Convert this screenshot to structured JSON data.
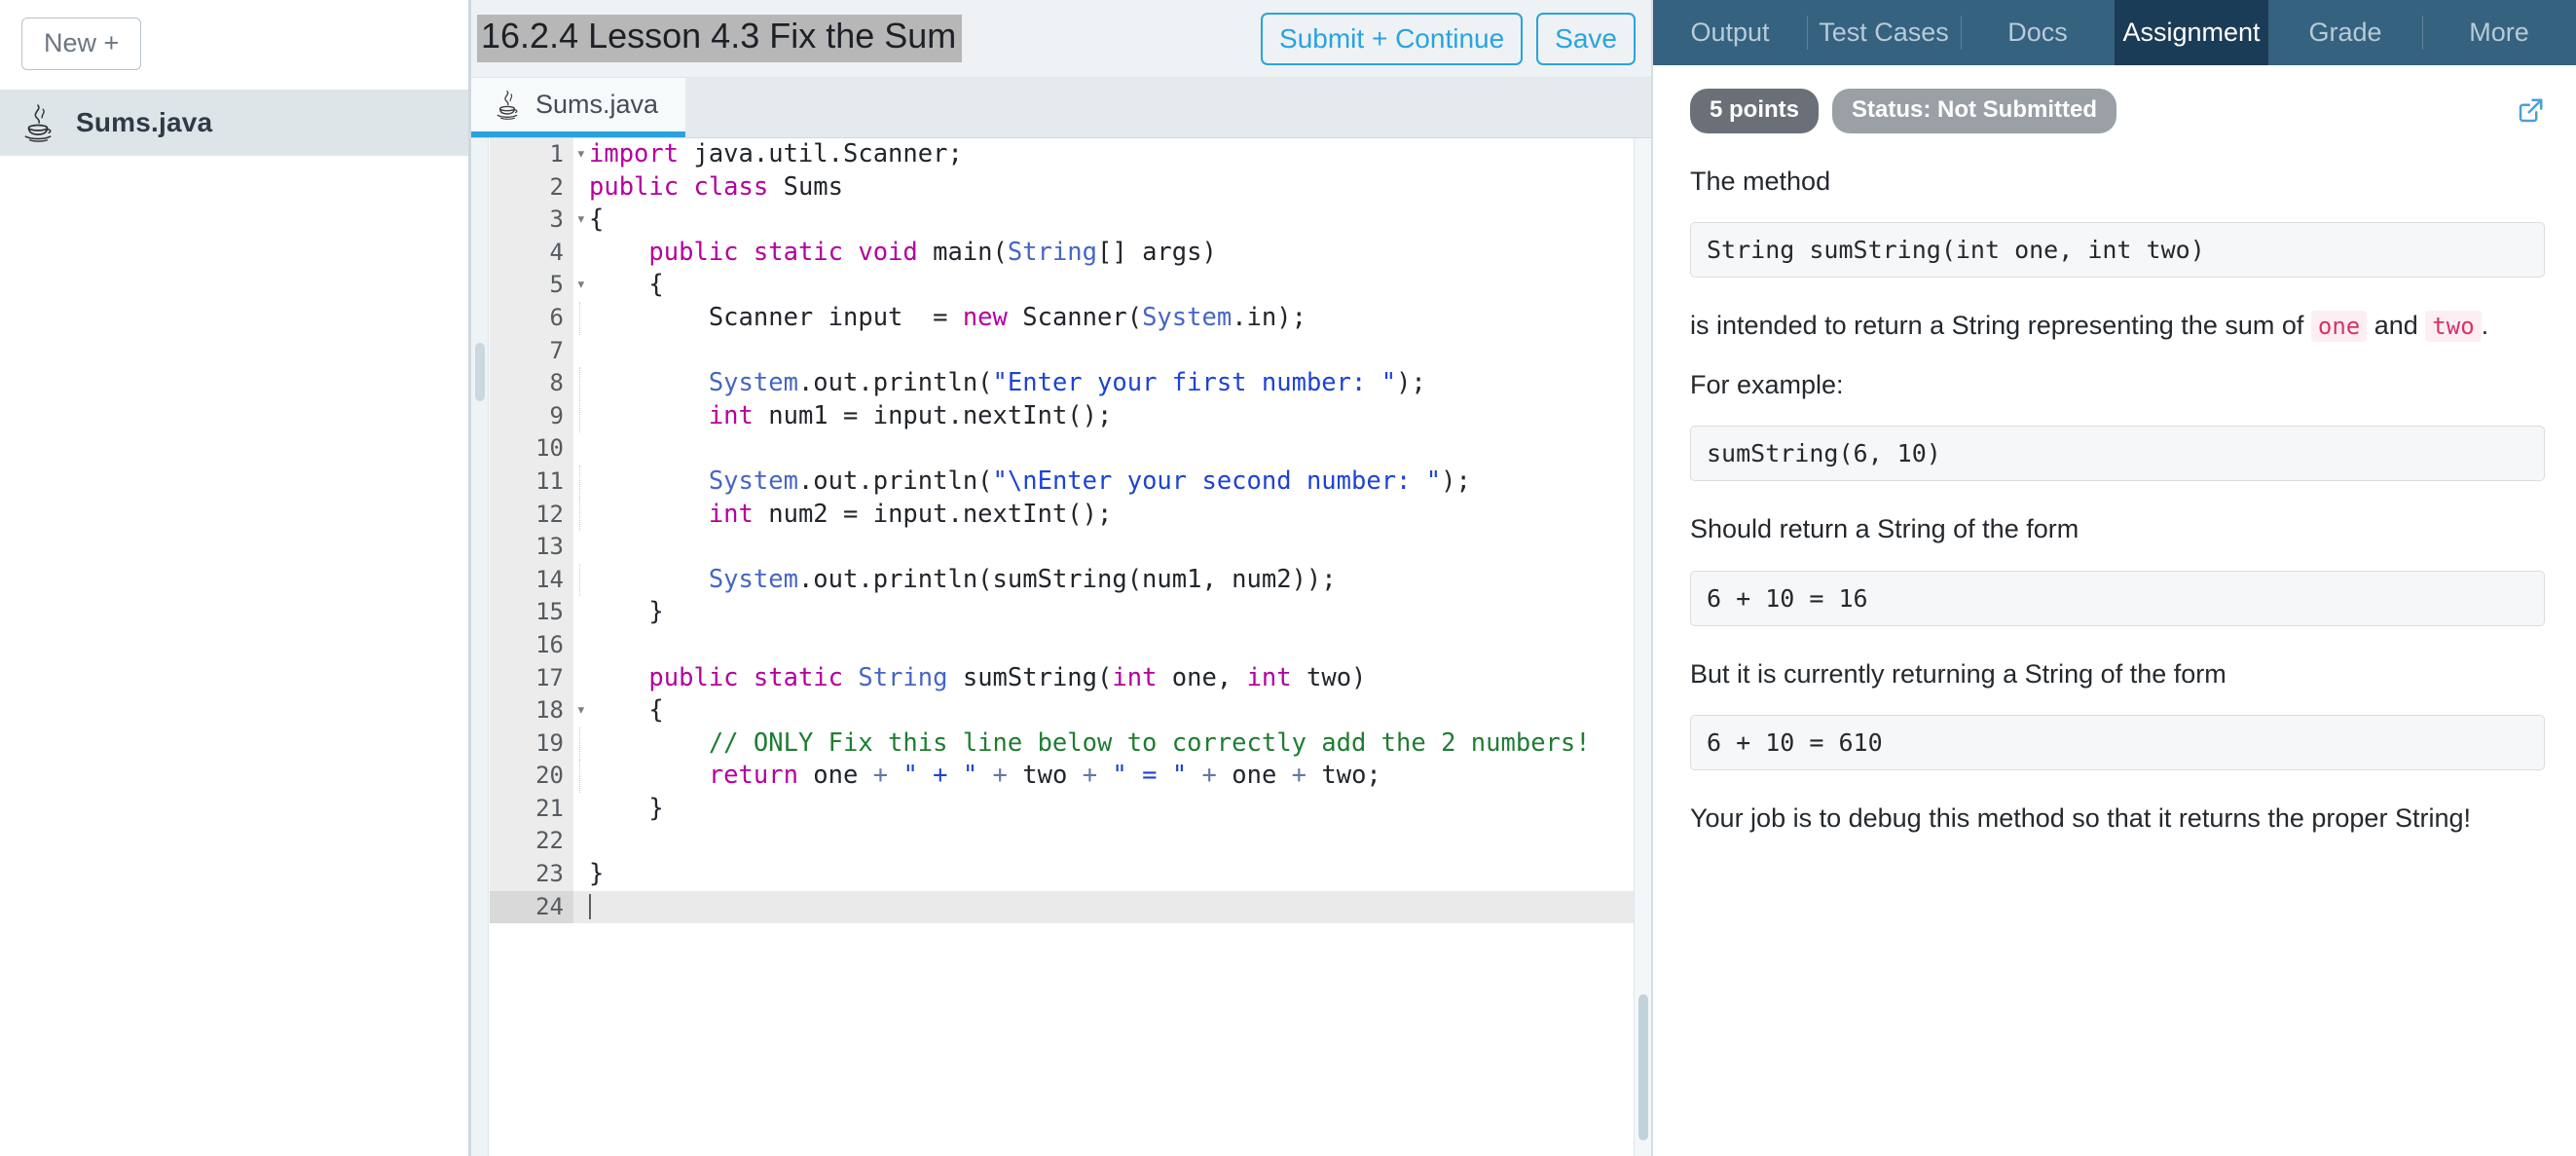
{
  "sidebar": {
    "new_button_label": "New +",
    "files": [
      {
        "name": "Sums.java",
        "icon": "java-icon"
      }
    ]
  },
  "editor": {
    "title": "16.2.4 Lesson 4.3 Fix the Sum",
    "submit_button_label": "Submit + Continue",
    "save_button_label": "Save",
    "tabs": [
      {
        "label": "Sums.java",
        "icon": "java-icon",
        "active": true
      }
    ],
    "active_line": 24,
    "lines": [
      {
        "n": "1",
        "fold": "▾",
        "tokens": [
          {
            "t": "import ",
            "c": "k"
          },
          {
            "t": "java.util.Scanner;",
            "c": "pl"
          }
        ]
      },
      {
        "n": "2",
        "fold": "",
        "tokens": [
          {
            "t": "public class ",
            "c": "k"
          },
          {
            "t": "Sums",
            "c": "pl"
          }
        ]
      },
      {
        "n": "3",
        "fold": "▾",
        "tokens": [
          {
            "t": "{",
            "c": "pl"
          }
        ]
      },
      {
        "n": "4",
        "fold": "",
        "tokens": [
          {
            "t": "    ",
            "c": "pl"
          },
          {
            "t": "public static void ",
            "c": "k"
          },
          {
            "t": "main(",
            "c": "pl"
          },
          {
            "t": "String",
            "c": "ty"
          },
          {
            "t": "[] args)",
            "c": "pl"
          }
        ]
      },
      {
        "n": "5",
        "fold": "▾",
        "tokens": [
          {
            "t": "    {",
            "c": "pl"
          }
        ]
      },
      {
        "n": "6",
        "fold": "",
        "tokens": [
          {
            "t": "        Scanner input  = ",
            "c": "pl"
          },
          {
            "t": "new ",
            "c": "k"
          },
          {
            "t": "Scanner(",
            "c": "pl"
          },
          {
            "t": "System",
            "c": "ty"
          },
          {
            "t": ".in);",
            "c": "pl"
          }
        ]
      },
      {
        "n": "7",
        "fold": "",
        "tokens": [
          {
            "t": "",
            "c": "pl"
          }
        ]
      },
      {
        "n": "8",
        "fold": "",
        "tokens": [
          {
            "t": "        ",
            "c": "pl"
          },
          {
            "t": "System",
            "c": "ty"
          },
          {
            "t": ".out.println(",
            "c": "pl"
          },
          {
            "t": "\"Enter your first number: \"",
            "c": "st"
          },
          {
            "t": ");",
            "c": "pl"
          }
        ]
      },
      {
        "n": "9",
        "fold": "",
        "tokens": [
          {
            "t": "        ",
            "c": "pl"
          },
          {
            "t": "int ",
            "c": "k"
          },
          {
            "t": "num1 = input.nextInt();",
            "c": "pl"
          }
        ]
      },
      {
        "n": "10",
        "fold": "",
        "tokens": [
          {
            "t": "",
            "c": "pl"
          }
        ]
      },
      {
        "n": "11",
        "fold": "",
        "tokens": [
          {
            "t": "        ",
            "c": "pl"
          },
          {
            "t": "System",
            "c": "ty"
          },
          {
            "t": ".out.println(",
            "c": "pl"
          },
          {
            "t": "\"\\nEnter your second number: \"",
            "c": "st"
          },
          {
            "t": ");",
            "c": "pl"
          }
        ]
      },
      {
        "n": "12",
        "fold": "",
        "tokens": [
          {
            "t": "        ",
            "c": "pl"
          },
          {
            "t": "int ",
            "c": "k"
          },
          {
            "t": "num2 = input.nextInt();",
            "c": "pl"
          }
        ]
      },
      {
        "n": "13",
        "fold": "",
        "tokens": [
          {
            "t": "",
            "c": "pl"
          }
        ]
      },
      {
        "n": "14",
        "fold": "",
        "tokens": [
          {
            "t": "        ",
            "c": "pl"
          },
          {
            "t": "System",
            "c": "ty"
          },
          {
            "t": ".out.println(sumString(num1, num2));",
            "c": "pl"
          }
        ]
      },
      {
        "n": "15",
        "fold": "",
        "tokens": [
          {
            "t": "    }",
            "c": "pl"
          }
        ]
      },
      {
        "n": "16",
        "fold": "",
        "tokens": [
          {
            "t": "",
            "c": "pl"
          }
        ]
      },
      {
        "n": "17",
        "fold": "",
        "tokens": [
          {
            "t": "    ",
            "c": "pl"
          },
          {
            "t": "public static ",
            "c": "k"
          },
          {
            "t": "String",
            "c": "ty"
          },
          {
            "t": " sumString(",
            "c": "pl"
          },
          {
            "t": "int ",
            "c": "k"
          },
          {
            "t": "one, ",
            "c": "pl"
          },
          {
            "t": "int ",
            "c": "k"
          },
          {
            "t": "two)",
            "c": "pl"
          }
        ]
      },
      {
        "n": "18",
        "fold": "▾",
        "tokens": [
          {
            "t": "    {",
            "c": "pl"
          }
        ]
      },
      {
        "n": "19",
        "fold": "",
        "tokens": [
          {
            "t": "        ",
            "c": "pl"
          },
          {
            "t": "// ONLY Fix this line below to correctly add the 2 numbers!",
            "c": "cm"
          }
        ]
      },
      {
        "n": "20",
        "fold": "",
        "tokens": [
          {
            "t": "        ",
            "c": "pl"
          },
          {
            "t": "return ",
            "c": "k"
          },
          {
            "t": "one ",
            "c": "pl"
          },
          {
            "t": "+ ",
            "c": "op"
          },
          {
            "t": "\" + \"",
            "c": "st"
          },
          {
            "t": " + ",
            "c": "op"
          },
          {
            "t": "two ",
            "c": "pl"
          },
          {
            "t": "+ ",
            "c": "op"
          },
          {
            "t": "\" = \"",
            "c": "st"
          },
          {
            "t": " + ",
            "c": "op"
          },
          {
            "t": "one ",
            "c": "pl"
          },
          {
            "t": "+ ",
            "c": "op"
          },
          {
            "t": "two;",
            "c": "pl"
          }
        ]
      },
      {
        "n": "21",
        "fold": "",
        "tokens": [
          {
            "t": "    }",
            "c": "pl"
          }
        ]
      },
      {
        "n": "22",
        "fold": "",
        "tokens": [
          {
            "t": "",
            "c": "pl"
          }
        ]
      },
      {
        "n": "23",
        "fold": "",
        "tokens": [
          {
            "t": "}",
            "c": "pl"
          }
        ]
      },
      {
        "n": "24",
        "fold": "",
        "tokens": [
          {
            "t": "",
            "c": "pl"
          }
        ]
      }
    ]
  },
  "right_panel": {
    "tabs": [
      {
        "label": "Output",
        "active": false
      },
      {
        "label": "Test Cases",
        "active": false
      },
      {
        "label": "Docs",
        "active": false
      },
      {
        "label": "Assignment",
        "active": true
      },
      {
        "label": "Grade",
        "active": false
      },
      {
        "label": "More",
        "active": false
      }
    ],
    "points_badge": "5 points",
    "status_badge": "Status: Not Submitted",
    "external_link_icon": "external-link-icon",
    "blocks": [
      {
        "type": "para",
        "text": "The method"
      },
      {
        "type": "code",
        "text": "String sumString(int one, int two)"
      },
      {
        "type": "para_rich",
        "before": "is intended to return a String representing the sum of ",
        "code1": "one",
        "middle": " and ",
        "code2": "two",
        "after": "."
      },
      {
        "type": "para",
        "text": "For example:"
      },
      {
        "type": "code",
        "text": "sumString(6, 10)"
      },
      {
        "type": "para",
        "text": "Should return a String of the form"
      },
      {
        "type": "code",
        "text": "6 + 10 = 16"
      },
      {
        "type": "para",
        "text": "But it is currently returning a String of the form"
      },
      {
        "type": "code",
        "text": "6 + 10 = 610"
      },
      {
        "type": "para",
        "text": "Your job is to debug this method so that it returns the proper String!"
      }
    ]
  },
  "colors": {
    "accent_blue": "#29a3e0",
    "tabbar_dark": "#35627f",
    "tab_active_dark": "#1b3c56",
    "keyword": "#b4009e",
    "type": "#4666c4",
    "string": "#1d43d6",
    "comment": "#1e7d32"
  }
}
